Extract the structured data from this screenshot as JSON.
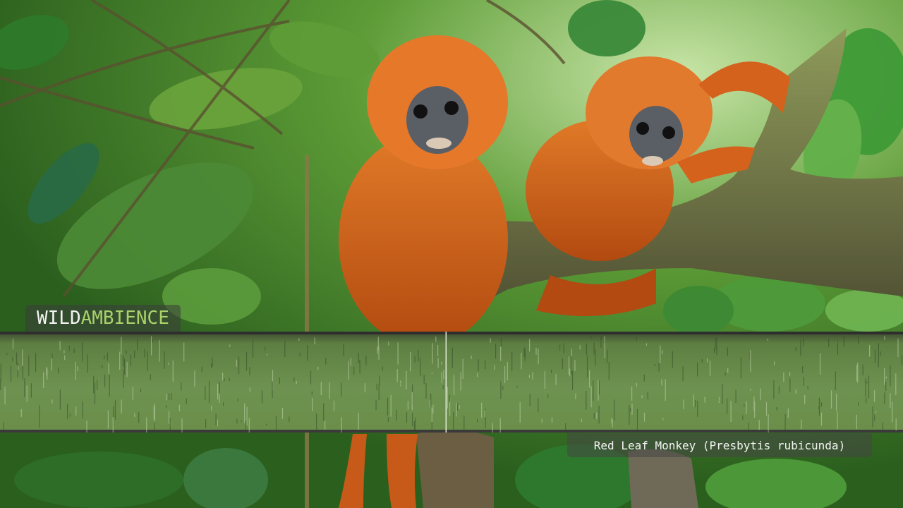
{
  "brand": {
    "name_part1": "WILD",
    "name_part2": "AMBIENCE",
    "color_part1": "#f2f2f2",
    "color_part2": "#a9d26a"
  },
  "caption": {
    "species_label": "Red Leaf Monkey (Presbytis rubicunda)"
  },
  "spectrogram": {
    "background_color": "#6b8f4a",
    "playhead_progress": 0.494
  },
  "scene": {
    "subject": "two red leaf monkeys on a mossy branch",
    "foliage_color": "#3f8a2c",
    "fur_color": "#c85a14",
    "face_color": "#5a5f66"
  }
}
